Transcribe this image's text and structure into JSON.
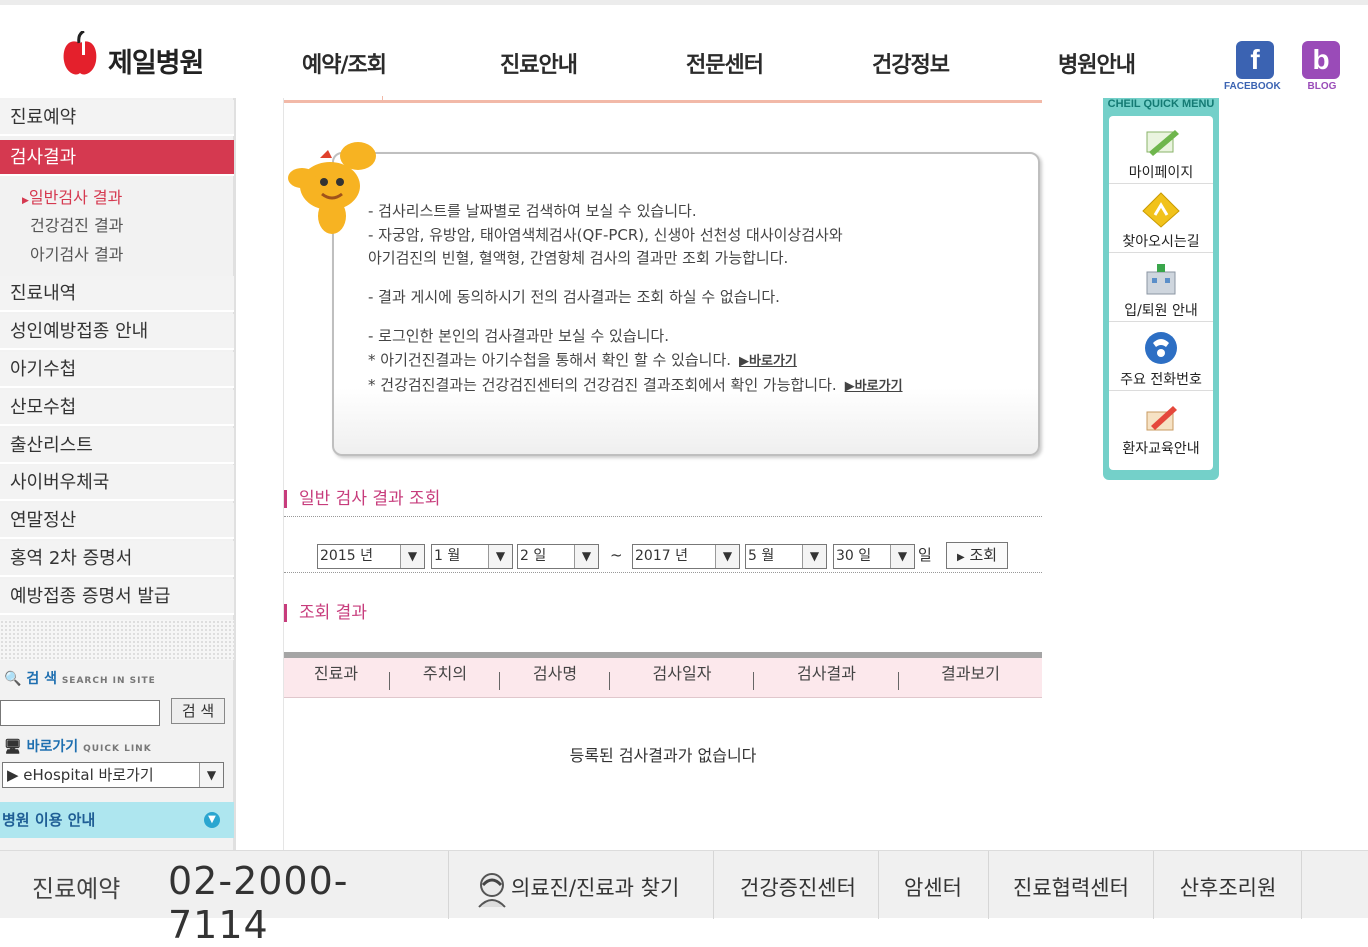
{
  "header": {
    "logo_text": "제일병원",
    "nav": [
      "예약/조회",
      "진료안내",
      "전문센터",
      "건강정보",
      "병원안내"
    ],
    "sns": [
      {
        "label": "FACEBOOK",
        "glyph": "f",
        "color": "#3b63b2"
      },
      {
        "label": "BLOG",
        "glyph": "b",
        "color": "#9a4bb8"
      }
    ]
  },
  "sidebar": {
    "items_top": [
      "진료예약",
      "검사결과"
    ],
    "sub_items": [
      "일반검사 결과",
      "건강검진 결과",
      "아기검사 결과"
    ],
    "items_bottom": [
      "진료내역",
      "성인예방접종 안내",
      "아기수첩",
      "산모수첩",
      "출산리스트",
      "사이버우체국",
      "연말정산",
      "홍역 2차 증명서",
      "예방접종 증명서 발급"
    ],
    "search_label": "검 색",
    "search_sub": "SEARCH IN SITE",
    "search_button": "검 색",
    "quick_label": "바로가기",
    "quick_sub": "QUICK LINK",
    "quick_select": "▶ eHospital 바로가기",
    "guide_label": "병원 이용 안내"
  },
  "info": {
    "lines": [
      "- 검사리스트를 날짜별로 검색하여 보실 수 있습니다.",
      "- 자궁암, 유방암, 태아염색체검사(QF-PCR), 신생아 선천성 대사이상검사와",
      "  아기검진의 빈혈, 혈액형, 간염항체 검사의 결과만 조회 가능합니다.",
      "- 결과 게시에 동의하시기 전의 검사결과는 조회 하실 수 없습니다.",
      "- 로그인한 본인의 검사결과만 보실 수 있습니다.",
      "* 아기건진결과는 아기수첩을 통해서 확인 할 수 있습니다.",
      "* 건강검진결과는 건강검진센터의 건강검진 결과조회에서 확인 가능합니다."
    ],
    "go_link": "▶바로가기"
  },
  "search_section": {
    "title": "일반 검사 결과 조회",
    "from_year": "2015 년",
    "from_month": "1 월",
    "from_day": "2 일",
    "tilde": "~",
    "to_year": "2017 년",
    "to_month": "5 월",
    "to_day": "30 일",
    "day_suffix": "일",
    "button": "조회"
  },
  "results": {
    "title": "조회 결과",
    "columns": [
      "진료과",
      "주치의",
      "검사명",
      "검사일자",
      "검사결과",
      "결과보기"
    ],
    "empty_message": "등록된 검사결과가 없습니다"
  },
  "quick_menu": {
    "title": "CHEIL QUICK MENU",
    "items": [
      "마이페이지",
      "찾아오시는길",
      "입/퇴원 안내",
      "주요 전화번호",
      "환자교육안내"
    ]
  },
  "footer": {
    "reserve_label": "진료예약",
    "phone": "02-2000-7114",
    "links": [
      "의료진/진료과 찾기",
      "건강증진센터",
      "암센터",
      "진료협력센터",
      "산후조리원"
    ]
  },
  "colors": {
    "accent": "#d53950",
    "section_title": "#c73c7c",
    "quick_menu": "#74d0c9",
    "guide_bar": "#aee6ef"
  }
}
